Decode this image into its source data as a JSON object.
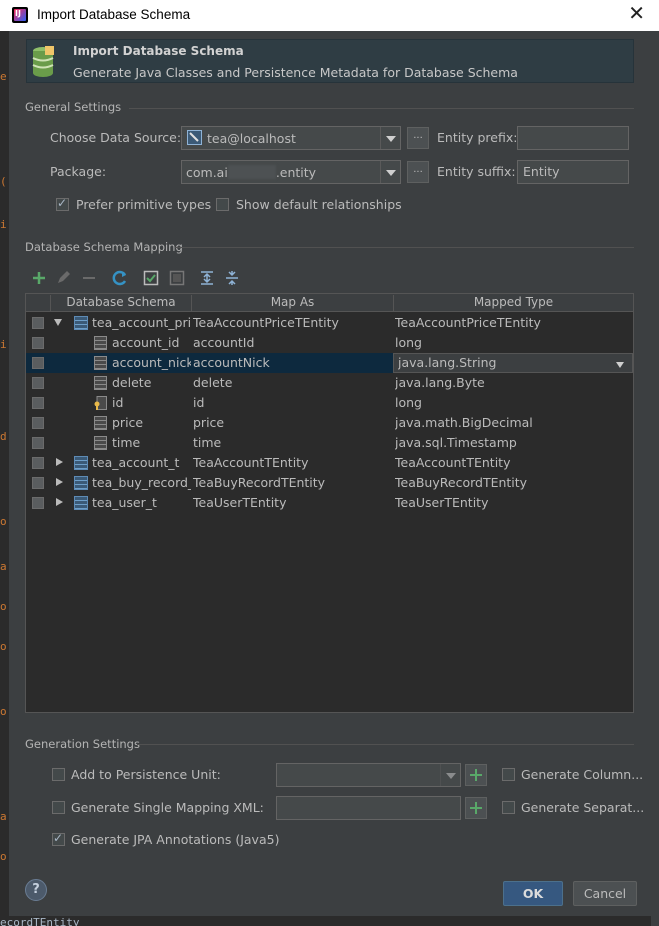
{
  "window": {
    "title": "Import Database Schema"
  },
  "header": {
    "title": "Import Database Schema",
    "description": "Generate Java Classes and Persistence Metadata for Database Schema"
  },
  "general": {
    "section": "General Settings",
    "data_source_label": "Choose Data Source:",
    "data_source_value": "tea@localhost",
    "entity_prefix_label": "Entity prefix:",
    "entity_prefix_value": "",
    "package_label": "Package:",
    "package_value_start": "com.ai",
    "package_value_end": ".entity",
    "entity_suffix_label": "Entity suffix:",
    "entity_suffix_value": "Entity",
    "more_button": "...",
    "prefer_primitive": {
      "label": "Prefer primitive types",
      "checked": true
    },
    "show_relationships": {
      "label": "Show default relationships",
      "checked": false
    }
  },
  "mapping": {
    "section": "Database Schema Mapping",
    "toolbar_icons": [
      "add-icon",
      "edit-icon",
      "remove-icon",
      "refresh-icon",
      "check-all-icon",
      "uncheck-all-icon",
      "expand-all-icon",
      "collapse-all-icon"
    ],
    "columns": [
      "Database Schema",
      "Map As",
      "Mapped Type"
    ],
    "rows": [
      {
        "schema": "tea_account_price_t",
        "map_as": "TeaAccountPriceTEntity",
        "type": "TeaAccountPriceTEntity"
      },
      {
        "schema": "account_id",
        "map_as": "accountId",
        "type": "long"
      },
      {
        "schema": "account_nick",
        "map_as": "accountNick",
        "type": "java.lang.String"
      },
      {
        "schema": "delete",
        "map_as": "delete",
        "type": "java.lang.Byte"
      },
      {
        "schema": "id",
        "map_as": "id",
        "type": "long"
      },
      {
        "schema": "price",
        "map_as": "price",
        "type": "java.math.BigDecimal"
      },
      {
        "schema": "time",
        "map_as": "time",
        "type": "java.sql.Timestamp"
      },
      {
        "schema": "tea_account_t",
        "map_as": "TeaAccountTEntity",
        "type": "TeaAccountTEntity"
      },
      {
        "schema": "tea_buy_record_t",
        "map_as": "TeaBuyRecordTEntity",
        "type": "TeaBuyRecordTEntity"
      },
      {
        "schema": "tea_user_t",
        "map_as": "TeaUserTEntity",
        "type": "TeaUserTEntity"
      }
    ]
  },
  "generation": {
    "section": "Generation Settings",
    "add_persistence": {
      "label": "Add to Persistence Unit:",
      "checked": false,
      "value": ""
    },
    "single_mapping": {
      "label": "Generate Single Mapping XML:",
      "checked": false,
      "value": ""
    },
    "generate_columns": {
      "label": "Generate Column...",
      "checked": false
    },
    "generate_separate": {
      "label": "Generate Separat...",
      "checked": false
    },
    "jpa_annotations": {
      "label": "Generate JPA Annotations (Java5)",
      "checked": true
    }
  },
  "buttons": {
    "help": "?",
    "ok": "OK",
    "cancel": "Cancel"
  },
  "background": {
    "bottom_text": "ecordTEntity"
  },
  "colors": {
    "selection": "#0d293e",
    "accent": "#365880",
    "add_green": "#59a869"
  }
}
